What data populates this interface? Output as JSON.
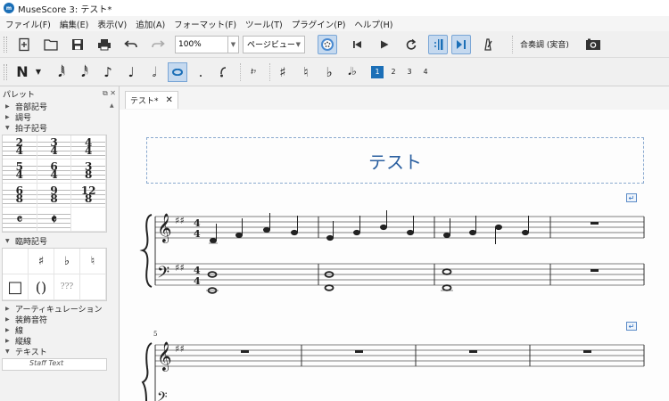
{
  "window": {
    "title": "MuseScore 3: テスト*",
    "app_icon": "musescore-icon"
  },
  "menu": [
    "ファイル(F)",
    "編集(E)",
    "表示(V)",
    "追加(A)",
    "フォーマット(F)",
    "ツール(T)",
    "プラグイン(P)",
    "ヘルプ(H)"
  ],
  "toolbar": {
    "zoom_value": "100%",
    "view_mode": "ページビュー",
    "concert_pitch": "合奏調 (実音)",
    "icons": [
      "new-score-icon",
      "open-icon",
      "save-icon",
      "print-icon",
      "undo-icon",
      "redo-icon",
      "midi-input-icon",
      "rewind-icon",
      "play-icon",
      "loop-icon",
      "repeat-icon",
      "pan-icon",
      "metronome-icon",
      "image-capture-icon"
    ]
  },
  "note_input": {
    "mode_label": "N",
    "voices": [
      "1",
      "2",
      "3",
      "4"
    ],
    "active_voice": "1"
  },
  "palette": {
    "title": "パレット",
    "sections_before": [
      "音部記号",
      "調号"
    ],
    "time_sig_section": "拍子記号",
    "time_signatures": [
      [
        "2",
        "4"
      ],
      [
        "3",
        "4"
      ],
      [
        "4",
        "4"
      ],
      [
        "5",
        "4"
      ],
      [
        "6",
        "4"
      ],
      [
        "3",
        "8"
      ],
      [
        "6",
        "8"
      ],
      [
        "9",
        "8"
      ],
      [
        "12",
        "8"
      ],
      [
        "𝄴",
        ""
      ],
      [
        "𝄵",
        ""
      ]
    ],
    "accidentals_section": "臨時記号",
    "accidentals": [
      "",
      "♯",
      "♭",
      "♮",
      "□",
      "()",
      "???",
      ""
    ],
    "sections_after": [
      "アーティキュレーション",
      "装飾音符",
      "線",
      "縦線",
      "テキスト"
    ],
    "truncated_item": "Staff Text"
  },
  "score": {
    "tab_label": "テスト*",
    "title": "テスト",
    "measure_number": "5"
  }
}
